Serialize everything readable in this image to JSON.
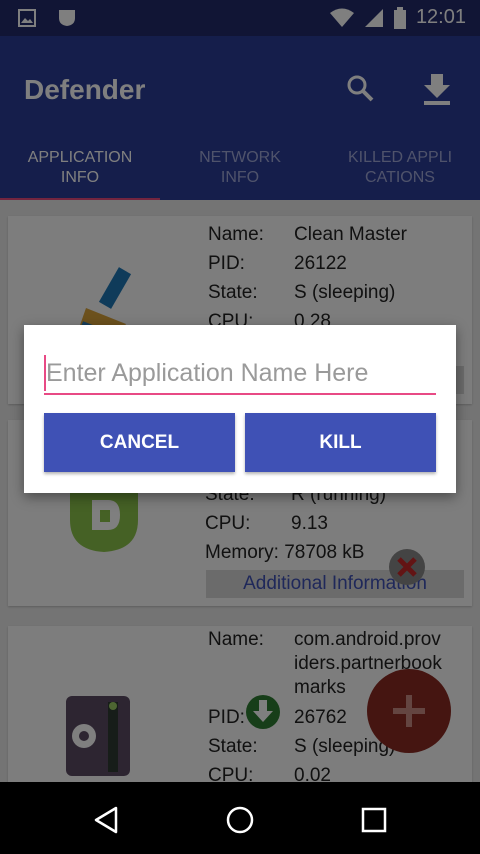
{
  "status_bar": {
    "time": "12:01",
    "icons": [
      "image-icon",
      "shield-icon",
      "wifi-icon",
      "signal-icon",
      "battery-icon"
    ]
  },
  "app_bar": {
    "title": "Defender",
    "icons": [
      "search-icon",
      "download-icon"
    ]
  },
  "tabs": [
    {
      "label_line1": "APPLICATION",
      "label_line2": "INFO",
      "selected": true
    },
    {
      "label_line1": "NETWORK",
      "label_line2": "INFO",
      "selected": false
    },
    {
      "label_line1": "KILLED APPLI",
      "label_line2": "CATIONS",
      "selected": false
    }
  ],
  "cards": [
    {
      "icon": "broom-icon",
      "fields": [
        {
          "label": "Name:",
          "value": "Clean Master"
        },
        {
          "label": "PID:",
          "value": "26122"
        },
        {
          "label": "State:",
          "value": "S (sleeping)"
        },
        {
          "label": "CPU:",
          "value": "0.28"
        }
      ]
    },
    {
      "icon": "defender-logo-icon",
      "fields": [
        {
          "label": "State:",
          "value": "R (running)"
        },
        {
          "label": "CPU:",
          "value": "9.13"
        },
        {
          "label": "Memory:",
          "value": "78708 kB"
        }
      ],
      "additional_label": "Additional Information"
    },
    {
      "icon": "settings-app-icon",
      "fields": [
        {
          "label": "Name:",
          "value_lines": [
            "com.android.prov",
            "iders.partnerbook",
            "marks"
          ]
        },
        {
          "label": "PID:",
          "value": "26762"
        },
        {
          "label": "State:",
          "value": "S (sleeping)"
        },
        {
          "label": "CPU:",
          "value": "0.02"
        }
      ]
    }
  ],
  "dialog": {
    "input_placeholder": "Enter Application Name Here",
    "input_value": "",
    "cancel_label": "CANCEL",
    "kill_label": "KILL"
  },
  "fab": {
    "icon": "plus-icon"
  },
  "nav_bar": {
    "icons": [
      "back-icon",
      "home-icon",
      "recents-icon"
    ]
  },
  "colors": {
    "primary": "#3f51b5",
    "primary_dark": "#2b3c97",
    "accent": "#e84a85",
    "fab": "#f44336"
  }
}
